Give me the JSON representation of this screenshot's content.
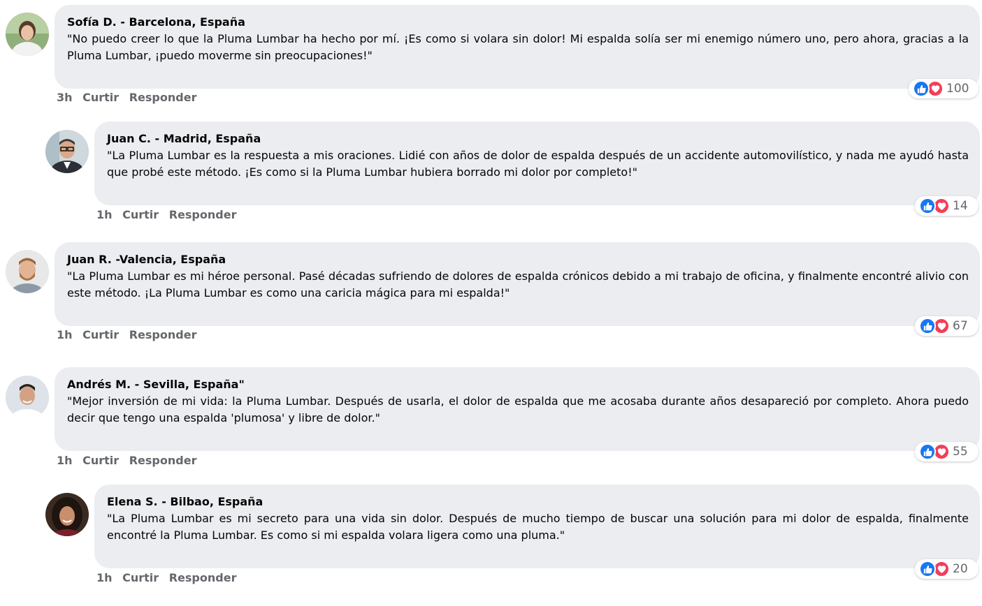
{
  "comments": [
    {
      "author": "Sofía D. - Barcelona, España",
      "text": "\"No puedo creer lo que la Pluma Lumbar ha hecho por mí. ¡Es como si volara sin dolor! Mi espalda solía ser mi enemigo número uno, pero ahora, gracias a la Pluma Lumbar, ¡puedo moverme sin preocupaciones!\"",
      "time": "3h",
      "like_label": "Curtir",
      "reply_label": "Responder",
      "reaction_count": "100",
      "avatar_icon": "woman-avatar-photo"
    },
    {
      "author": "Juan C. - Madrid, España",
      "text": "\"La Pluma Lumbar es la respuesta a mis oraciones. Lidié con años de dolor de espalda después de un accidente automovilístico, y nada me ayudó hasta que probé este método. ¡Es como si la Pluma Lumbar hubiera borrado mi dolor por completo!\"",
      "time": "1h",
      "like_label": "Curtir",
      "reply_label": "Responder",
      "reaction_count": "14",
      "avatar_icon": "man-glasses-avatar-photo"
    },
    {
      "author": "Juan R. -Valencia, España",
      "text": "\"La Pluma Lumbar es mi héroe personal. Pasé décadas sufriendo de dolores de espalda crónicos debido a mi trabajo de oficina, y finalmente encontré alivio con este método. ¡La Pluma Lumbar es como una caricia mágica para mi espalda!\"",
      "time": "1h",
      "like_label": "Curtir",
      "reply_label": "Responder",
      "reaction_count": "67",
      "avatar_icon": "bearded-man-avatar-photo"
    },
    {
      "author": "Andrés M. - Sevilla, España\"",
      "text": "\"Mejor inversión de mi vida: la Pluma Lumbar. Después de usarla, el dolor de espalda que me acosaba durante años desapareció por completo. Ahora puedo decir que tengo una espalda 'plumosa' y libre de dolor.\"",
      "time": "1h",
      "like_label": "Curtir",
      "reply_label": "Responder",
      "reaction_count": "55",
      "avatar_icon": "smiling-man-avatar-photo"
    },
    {
      "author": "Elena S. - Bilbao, España",
      "text": "\"La Pluma Lumbar es mi secreto para una vida sin dolor. Después de mucho tiempo de buscar una solución para mi dolor de espalda, finalmente encontré la Pluma Lumbar. Es como si mi espalda volara ligera como una pluma.\"",
      "time": "1h",
      "like_label": "Curtir",
      "reply_label": "Responder",
      "reaction_count": "20",
      "avatar_icon": "woman-dark-hair-avatar-photo"
    }
  ],
  "colors": {
    "bubble": "#ebedf0",
    "meta_text": "#65676b",
    "like_blue": "#1877f2",
    "love_red": "#f33e58"
  }
}
